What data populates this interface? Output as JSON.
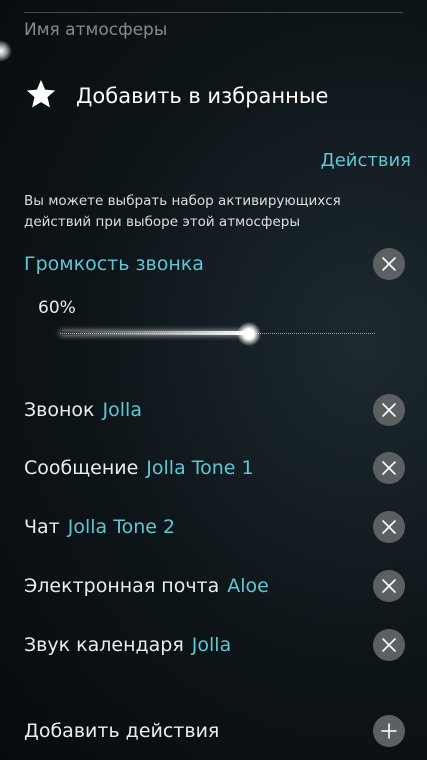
{
  "profile": {
    "name_label": "Имя атмосферы",
    "favorite_label": "Добавить в избранные"
  },
  "actions": {
    "header": "Действия",
    "hint": "Вы можете выбрать набор активирующихся действий при выборе этой атмосферы",
    "volume": {
      "label": "Громкость звонка",
      "value_text": "60%",
      "value": 0.6
    },
    "items": [
      {
        "label": "Звонок",
        "value": "Jolla"
      },
      {
        "label": "Сообщение",
        "value": "Jolla Tone 1"
      },
      {
        "label": "Чат",
        "value": "Jolla Tone 2"
      },
      {
        "label": "Электронная почта",
        "value": "Aloe"
      },
      {
        "label": "Звук календаря",
        "value": "Jolla"
      }
    ],
    "add_label": "Добавить действия"
  },
  "colors": {
    "accent": "#5fc6d3",
    "icon_bg": "#5b6163"
  },
  "icons": {
    "favorite": "star-icon",
    "remove": "close-icon",
    "add": "plus-icon"
  }
}
